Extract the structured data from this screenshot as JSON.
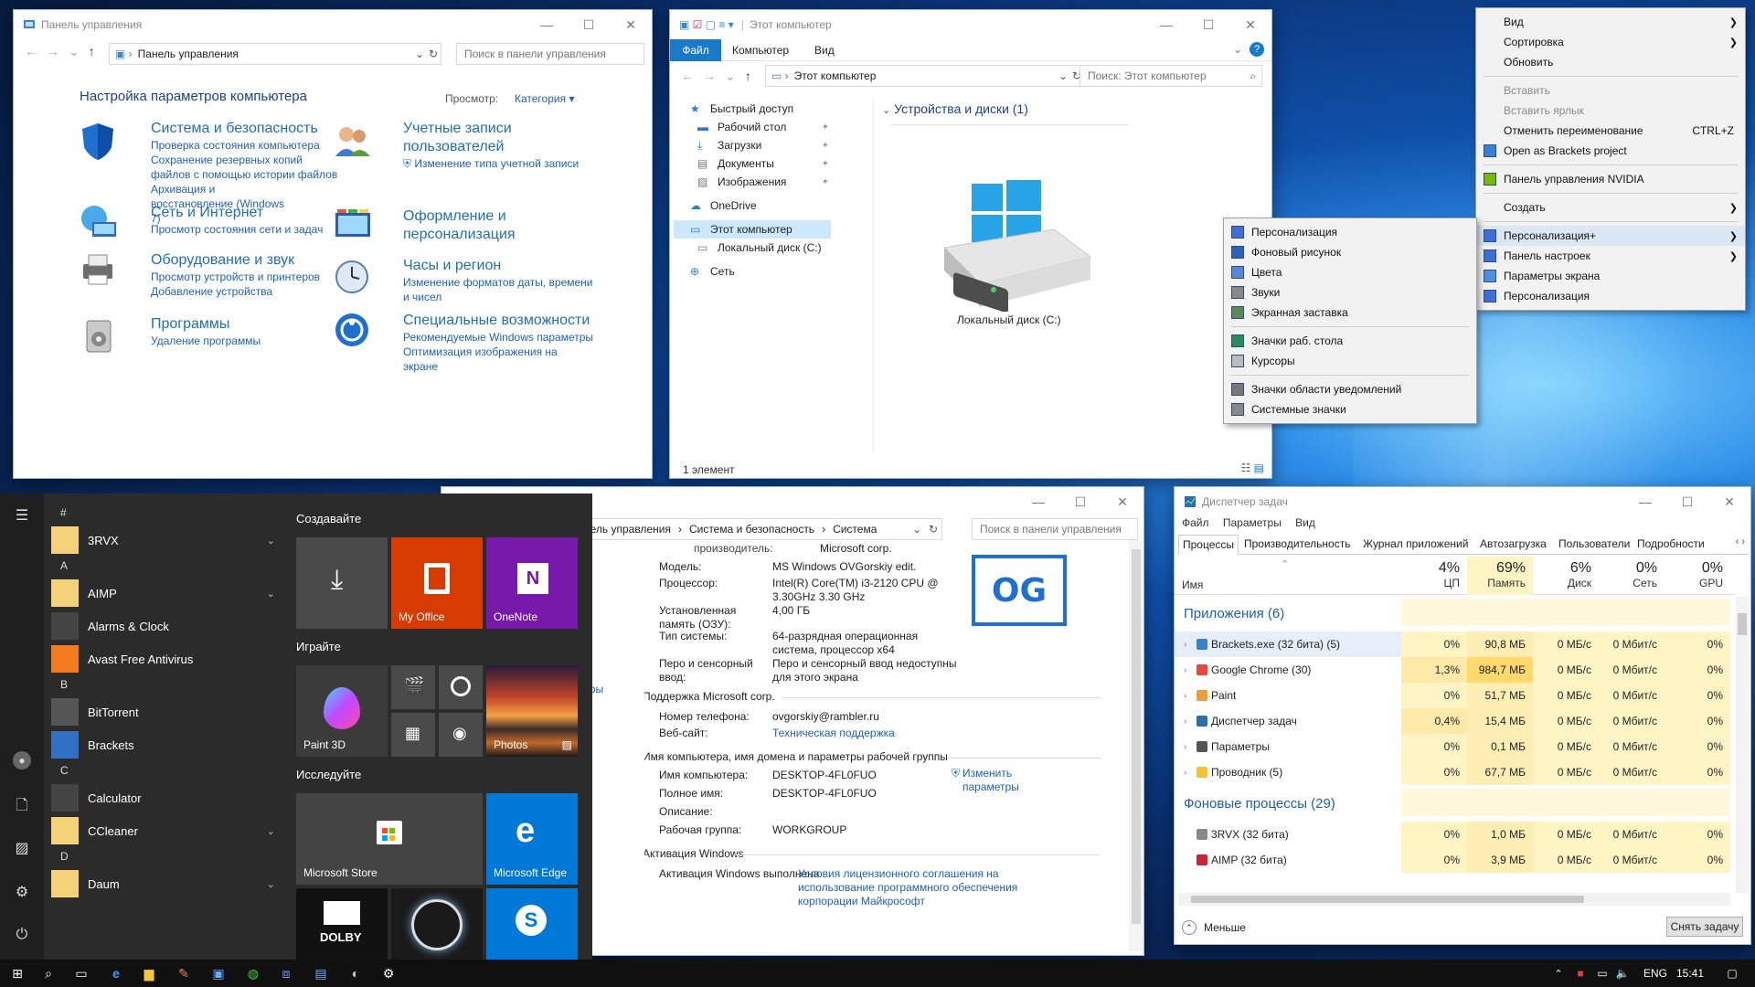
{
  "colors": {
    "accent": "#0078d7",
    "link": "#1f5fbf",
    "cp_heading": "#1f6fb5",
    "start_bg": "#2b2b2b",
    "office": "#d83b01",
    "onenote": "#7719aa",
    "store": "#444444",
    "edge": "#0078d7",
    "skype": "#0078d7",
    "mem_highlight": "#ffd96e",
    "cpu_bg": "#fff4c4"
  },
  "control_panel": {
    "title": "Панель управления",
    "address": "Панель управления",
    "search_placeholder": "Поиск в панели управления",
    "heading": "Настройка параметров компьютера",
    "view_label": "Просмотр:",
    "view_value": "Категория",
    "categories": [
      {
        "icon": "shield-icon",
        "title": "Система и безопасность",
        "links": [
          "Проверка состояния компьютера",
          "Сохранение резервных копий файлов с помощью истории файлов",
          "Архивация и восстановление (Windows 7)"
        ]
      },
      {
        "icon": "network-icon",
        "title": "Сеть и Интернет",
        "links": [
          "Просмотр состояния сети и задач"
        ]
      },
      {
        "icon": "printer-icon",
        "title": "Оборудование и звук",
        "links": [
          "Просмотр устройств и принтеров",
          "Добавление устройства"
        ]
      },
      {
        "icon": "programs-icon",
        "title": "Программы",
        "links": [
          "Удаление программы"
        ]
      },
      {
        "icon": "users-icon",
        "title": "Учетные записи пользователей",
        "links": [
          "Изменение типа учетной записи"
        ]
      },
      {
        "icon": "appearance-icon",
        "title": "Оформление и персонализация",
        "links": []
      },
      {
        "icon": "clock-icon",
        "title": "Часы и регион",
        "links": [
          "Изменение форматов даты, времени и чисел"
        ]
      },
      {
        "icon": "accessibility-icon",
        "title": "Специальные возможности",
        "links": [
          "Рекомендуемые Windows параметры",
          "Оптимизация изображения на экране"
        ]
      }
    ]
  },
  "explorer": {
    "title": "Этот компьютер",
    "ribbon_tabs": [
      "Файл",
      "Компьютер",
      "Вид"
    ],
    "address": "Этот компьютер",
    "search_placeholder": "Поиск: Этот компьютер",
    "nav": [
      {
        "label": "Быстрый доступ",
        "icon": "star-icon"
      },
      {
        "label": "Рабочий стол",
        "icon": "desktop-folder-icon",
        "pin": true
      },
      {
        "label": "Загрузки",
        "icon": "downloads-icon",
        "pin": true
      },
      {
        "label": "Документы",
        "icon": "documents-icon",
        "pin": true
      },
      {
        "label": "Изображения",
        "icon": "pictures-icon",
        "pin": true
      },
      {
        "label": "OneDrive",
        "icon": "cloud-icon"
      },
      {
        "label": "Этот компьютер",
        "icon": "computer-icon",
        "selected": true
      },
      {
        "label": "Локальный диск (C:)",
        "icon": "drive-icon"
      },
      {
        "label": "Сеть",
        "icon": "network-icon"
      }
    ],
    "group_header": "Устройства и диски (1)",
    "drive_label": "Локальный диск (C:)",
    "status": "1 элемент"
  },
  "context_menu": {
    "items": [
      {
        "label": "Вид",
        "arrow": true
      },
      {
        "label": "Сортировка",
        "arrow": true
      },
      {
        "label": "Обновить"
      },
      {
        "sep": true
      },
      {
        "label": "Вставить",
        "disabled": true
      },
      {
        "label": "Вставить ярлык",
        "disabled": true
      },
      {
        "label": "Отменить переименование",
        "shortcut": "CTRL+Z"
      },
      {
        "label": "Open as Brackets project",
        "icon": "brackets-icon"
      },
      {
        "sep": true
      },
      {
        "label": "Панель управления NVIDIA",
        "icon": "nvidia-icon"
      },
      {
        "sep": true
      },
      {
        "label": "Создать",
        "arrow": true
      },
      {
        "sep": true
      },
      {
        "label": "Персонализация+",
        "icon": "personalize-icon",
        "arrow": true,
        "highlight": true
      },
      {
        "label": "Панель настроек",
        "icon": "panel-icon",
        "arrow": true
      },
      {
        "label": "Параметры экрана",
        "icon": "display-icon"
      },
      {
        "label": "Персонализация",
        "icon": "personalize-icon"
      }
    ]
  },
  "submenu": {
    "items": [
      {
        "label": "Персонализация",
        "icon": "personalize-icon"
      },
      {
        "label": "Фоновый рисунок",
        "icon": "wallpaper-icon"
      },
      {
        "label": "Цвета",
        "icon": "colors-icon"
      },
      {
        "label": "Звуки",
        "icon": "sounds-icon"
      },
      {
        "label": "Экранная заставка",
        "icon": "screensaver-icon"
      },
      {
        "sep": true
      },
      {
        "label": "Значки раб. стола",
        "icon": "desktop-icons-icon"
      },
      {
        "label": "Курсоры",
        "icon": "cursor-icon"
      },
      {
        "sep": true
      },
      {
        "label": "Значки области уведомлений",
        "icon": "tray-icon"
      },
      {
        "label": "Системные значки",
        "icon": "system-icons-icon"
      }
    ]
  },
  "system": {
    "breadcrumb": [
      "нель управления",
      "Система и безопасность",
      "Система"
    ],
    "search_placeholder": "Поиск в панели управления",
    "left_link": "етры",
    "top_cut": "производитель:",
    "top_cut_value": "Microsoft corp.",
    "rows": [
      {
        "label": "Модель:",
        "value": "MS Windows OVGorskiy edit."
      },
      {
        "label": "Процессор:",
        "value": "Intel(R) Core(TM) i3-2120 CPU @ 3.30GHz   3.30 GHz"
      },
      {
        "label": "Установленная память (ОЗУ):",
        "value": "4,00 ГБ"
      },
      {
        "label": "Тип системы:",
        "value": "64-разрядная операционная система, процессор x64"
      },
      {
        "label": "Перо и сенсорный ввод:",
        "value": "Перо и сенсорный ввод недоступны для этого экрана"
      }
    ],
    "support_header": "Поддержка Microsoft corp.",
    "support_rows": [
      {
        "label": "Номер телефона:",
        "value": "ovgorskiy@rambler.ru"
      },
      {
        "label": "Веб-сайт:",
        "value": "Техническая поддержка",
        "link": true
      }
    ],
    "name_header": "Имя компьютера, имя домена и параметры рабочей группы",
    "name_rows": [
      {
        "label": "Имя компьютера:",
        "value": "DESKTOP-4FL0FUO"
      },
      {
        "label": "Полное имя:",
        "value": "DESKTOP-4FL0FUO"
      },
      {
        "label": "Описание:",
        "value": ""
      },
      {
        "label": "Рабочая группа:",
        "value": "WORKGROUP"
      }
    ],
    "change_link": "Изменить параметры",
    "activation_header": "Активация Windows",
    "activation_label": "Активация Windows выполнена",
    "activation_link": "Условия лицензионного соглашения на использование программного обеспечения корпорации Майкрософт",
    "logo_text": "OG"
  },
  "task_manager": {
    "title": "Диспетчер задач",
    "menu": [
      "Файл",
      "Параметры",
      "Вид"
    ],
    "tabs": [
      "Процессы",
      "Производительность",
      "Журнал приложений",
      "Автозагрузка",
      "Пользователи",
      "Подробности"
    ],
    "col_name": "Имя",
    "columns": [
      {
        "pct": "4%",
        "label": "ЦП"
      },
      {
        "pct": "69%",
        "label": "Память"
      },
      {
        "pct": "6%",
        "label": "Диск"
      },
      {
        "pct": "0%",
        "label": "Сеть"
      },
      {
        "pct": "0%",
        "label": "GPU"
      }
    ],
    "apps_header": "Приложения (6)",
    "apps": [
      {
        "name": "Brackets.exe (32 бита) (5)",
        "icon": "brackets-icon",
        "cpu": "0%",
        "mem": "90,8 МБ",
        "disk": "0 МБ/с",
        "net": "0 Мбит/с",
        "gpu": "0%",
        "selected": true
      },
      {
        "name": "Google Chrome (30)",
        "icon": "chrome-icon",
        "cpu": "1,3%",
        "mem": "984,7 МБ",
        "disk": "0 МБ/с",
        "net": "0 Мбит/с",
        "gpu": "0%",
        "memhot": true
      },
      {
        "name": "Paint",
        "icon": "paint-icon",
        "cpu": "0%",
        "mem": "51,7 МБ",
        "disk": "0 МБ/с",
        "net": "0 Мбит/с",
        "gpu": "0%"
      },
      {
        "name": "Диспетчер задач",
        "icon": "taskmgr-icon",
        "cpu": "0,4%",
        "mem": "15,4 МБ",
        "disk": "0 МБ/с",
        "net": "0 Мбит/с",
        "gpu": "0%"
      },
      {
        "name": "Параметры",
        "icon": "settings-icon",
        "cpu": "0%",
        "mem": "0,1 МБ",
        "disk": "0 МБ/с",
        "net": "0 Мбит/с",
        "gpu": "0%"
      },
      {
        "name": "Проводник (5)",
        "icon": "explorer-icon",
        "cpu": "0%",
        "mem": "67,7 МБ",
        "disk": "0 МБ/с",
        "net": "0 Мбит/с",
        "gpu": "0%"
      }
    ],
    "bg_header": "Фоновые процессы (29)",
    "bg": [
      {
        "name": "3RVX (32 бита)",
        "icon": "speaker-icon",
        "cpu": "0%",
        "mem": "1,0 МБ",
        "disk": "0 МБ/с",
        "net": "0 Мбит/с",
        "gpu": "0%"
      },
      {
        "name": "AIMP (32 бита)",
        "icon": "aimp-icon",
        "cpu": "0%",
        "mem": "3,9 МБ",
        "disk": "0 МБ/с",
        "net": "0 Мбит/с",
        "gpu": "0%"
      }
    ],
    "fewer": "Меньше",
    "end_task": "Снять задачу"
  },
  "start_menu": {
    "apps": [
      {
        "type": "letter",
        "label": "#"
      },
      {
        "type": "app",
        "label": "3RVX",
        "icon": "folder-icon",
        "expand": true
      },
      {
        "type": "letter",
        "label": "A"
      },
      {
        "type": "app",
        "label": "AIMP",
        "icon": "folder-icon",
        "expand": true
      },
      {
        "type": "app",
        "label": "Alarms & Clock",
        "icon": "alarm-icon"
      },
      {
        "type": "app",
        "label": "Avast Free Antivirus",
        "icon": "avast-icon"
      },
      {
        "type": "letter",
        "label": "B"
      },
      {
        "type": "app",
        "label": "BitTorrent",
        "icon": "bittorrent-icon"
      },
      {
        "type": "app",
        "label": "Brackets",
        "icon": "brackets-icon"
      },
      {
        "type": "letter",
        "label": "C"
      },
      {
        "type": "app",
        "label": "Calculator",
        "icon": "calculator-icon"
      },
      {
        "type": "app",
        "label": "CCleaner",
        "icon": "folder-icon",
        "expand": true
      },
      {
        "type": "letter",
        "label": "D"
      },
      {
        "type": "app",
        "label": "Daum",
        "icon": "folder-icon",
        "expand": true
      }
    ],
    "groups": [
      "Создавайте",
      "Играйте",
      "Исследуйте"
    ],
    "tiles": {
      "office": "My Office",
      "onenote": "OneNote",
      "paint3d": "Paint 3D",
      "photos": "Photos",
      "store": "Microsoft Store",
      "edge": "Microsoft Edge",
      "dolby": "DOLBY"
    }
  },
  "taskbar": {
    "lang": "ENG",
    "time": "15:41"
  }
}
